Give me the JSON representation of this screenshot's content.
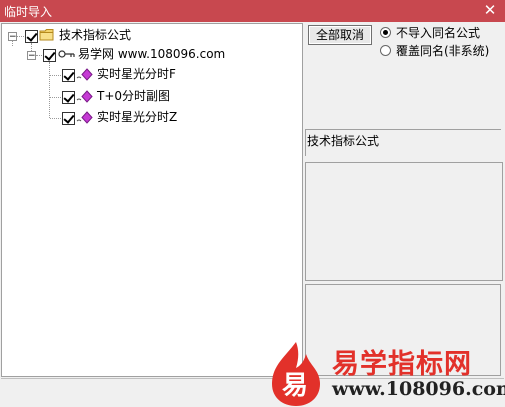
{
  "window": {
    "title": "临时导入",
    "close_glyph": "✕"
  },
  "tree": {
    "root": {
      "label": "技术指标公式",
      "checked": true,
      "expanded": true,
      "icon": "folder-icon"
    },
    "source": {
      "label": "易学网 www.108096.com",
      "checked": true,
      "expanded": true,
      "icon": "key-icon"
    },
    "items": [
      {
        "label": "实时星光分时F",
        "checked": true,
        "icon": "formula-icon"
      },
      {
        "label": "T+0分时副图",
        "checked": true,
        "icon": "formula-icon"
      },
      {
        "label": "实时星光分时Z",
        "checked": true,
        "icon": "formula-icon"
      }
    ]
  },
  "controls": {
    "select_all_label": "全部取消",
    "radio_skip_label": "不导入同名公式",
    "radio_overwrite_label": "覆盖同名(非系统)",
    "selected_option": "不导入同名公式"
  },
  "info": {
    "category_label": "技术指标公式"
  },
  "watermark": {
    "logo_char": "易",
    "title": "易学指标网",
    "url": "www.108096.com",
    "color": "#e2312a"
  }
}
